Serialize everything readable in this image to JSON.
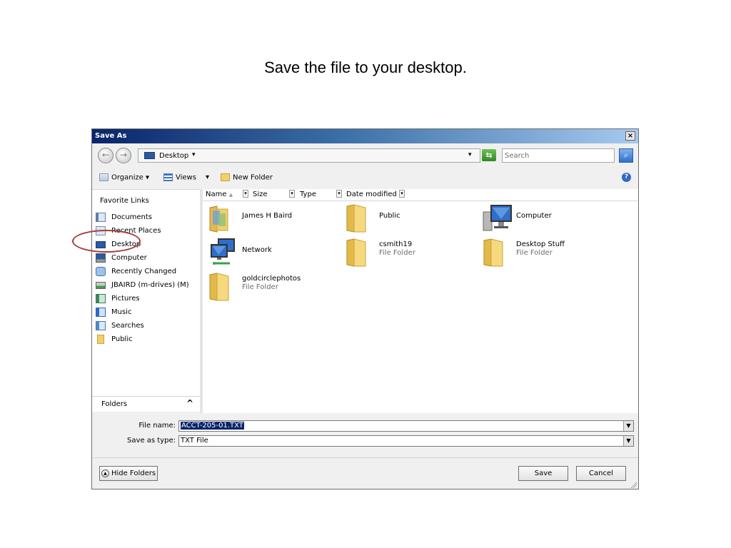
{
  "slide": {
    "title": "Save the file to your desktop."
  },
  "dialog": {
    "title": "Save As",
    "close_glyph": "×",
    "nav": {
      "back_glyph": "←",
      "forward_glyph": "→",
      "address_label": "Desktop",
      "address_chevron": "▾",
      "address_dropdown": "▾",
      "refresh_glyph": "⇆",
      "search_placeholder": "Search",
      "search_glyph": "⌕"
    },
    "toolbar": {
      "organize": "Organize ▾",
      "views": "Views",
      "views_chevron": "▾",
      "new_folder": "New Folder",
      "help": "?"
    },
    "sidebar": {
      "header": "Favorite Links",
      "items": [
        {
          "label": "Documents",
          "icon": "documents-icon"
        },
        {
          "label": "Recent Places",
          "icon": "recent-places-icon"
        },
        {
          "label": "Desktop",
          "icon": "desktop-icon"
        },
        {
          "label": "Computer",
          "icon": "computer-icon"
        },
        {
          "label": "Recently Changed",
          "icon": "recently-changed-icon"
        },
        {
          "label": "JBAIRD (m-drives) (M)",
          "icon": "network-drive-icon"
        },
        {
          "label": "Pictures",
          "icon": "pictures-icon"
        },
        {
          "label": "Music",
          "icon": "music-icon"
        },
        {
          "label": "Searches",
          "icon": "searches-icon"
        },
        {
          "label": "Public",
          "icon": "public-folder-icon"
        }
      ],
      "folders_label": "Folders",
      "folders_caret": "^"
    },
    "columns": {
      "name": "Name",
      "name_sort": "▲",
      "size": "Size",
      "type": "Type",
      "date": "Date modified",
      "sep_glyph": "▾"
    },
    "items": [
      {
        "name": "James H Baird",
        "sub": "",
        "icon": "user-folder-icon"
      },
      {
        "name": "Public",
        "sub": "",
        "icon": "folder-icon"
      },
      {
        "name": "Computer",
        "sub": "",
        "icon": "computer-icon"
      },
      {
        "name": "Network",
        "sub": "",
        "icon": "network-icon"
      },
      {
        "name": "csmith19",
        "sub": "File Folder",
        "icon": "folder-icon"
      },
      {
        "name": "Desktop Stuff",
        "sub": "File Folder",
        "icon": "folder-icon"
      },
      {
        "name": "goldcirclephotos",
        "sub": "File Folder",
        "icon": "folder-icon"
      }
    ],
    "form": {
      "filename_label": "File name:",
      "filename_value": "ACCT-205-01.TXT",
      "type_label": "Save as type:",
      "type_value": "TXT File",
      "dropdown_glyph": "▼"
    },
    "buttons": {
      "hide_folders": "Hide Folders",
      "hide_glyph": "▲",
      "save": "Save",
      "cancel": "Cancel"
    }
  },
  "colors": {
    "annotation_ring": "#a0413c",
    "folder": "#f2cf6b",
    "selection": "#0a246a"
  }
}
